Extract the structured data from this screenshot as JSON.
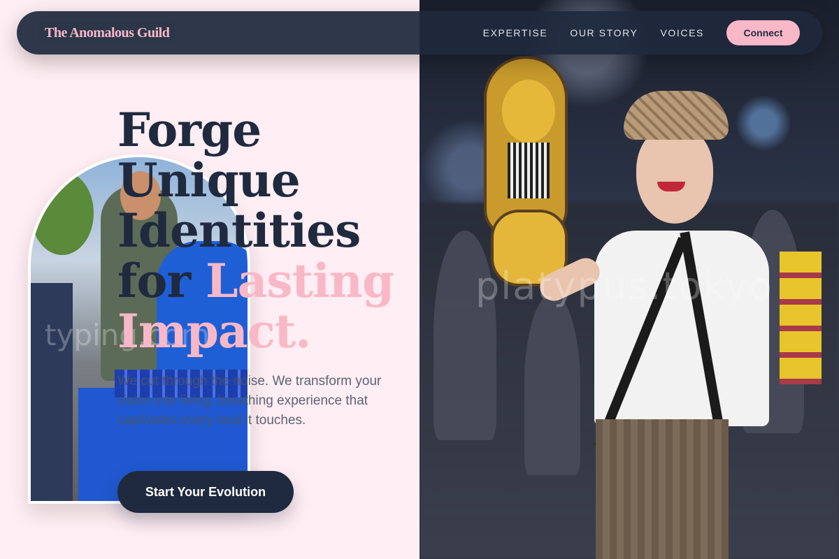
{
  "brand": {
    "logo_text": "The Anomalous Guild"
  },
  "nav": {
    "links": [
      "EXPERTISE",
      "OUR STORY",
      "VOICES"
    ],
    "cta_label": "Connect"
  },
  "hero": {
    "title_line1": "Forge",
    "title_line2": "Unique",
    "title_line3": "Identities",
    "title_for": "for ",
    "title_accent1": "Lasting",
    "title_accent2": "Impact.",
    "description": "We cut through the noise. We transform your vision into living, breathing experience that captivates every soul it touches.",
    "cta_label": "Start Your Evolution"
  },
  "watermarks": {
    "left": "typing.com",
    "right": "platypus.tokyo"
  },
  "colors": {
    "navy": "#1f2a3f",
    "pink": "#f9b8c7",
    "background": "#ffeef3"
  }
}
